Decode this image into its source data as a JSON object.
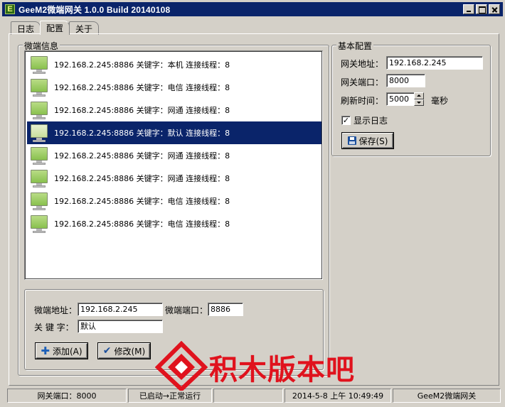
{
  "window": {
    "title": "GeeM2微端网关 1.0.0 Build 20140108",
    "icon_letter": "E"
  },
  "tabs": [
    {
      "label": "日志",
      "active": false
    },
    {
      "label": "配置",
      "active": true
    },
    {
      "label": "关于",
      "active": false
    }
  ],
  "client_info": {
    "group_label": "微端信息",
    "items": [
      {
        "text": "192.168.2.245:8886 关键字：本机 连接线程：8",
        "selected": false
      },
      {
        "text": "192.168.2.245:8886 关键字：电信 连接线程：8",
        "selected": false
      },
      {
        "text": "192.168.2.245:8886 关键字：网通 连接线程：8",
        "selected": false
      },
      {
        "text": "192.168.2.245:8886 关键字：默认 连接线程：8",
        "selected": true
      },
      {
        "text": "192.168.2.245:8886 关键字：网通 连接线程：8",
        "selected": false
      },
      {
        "text": "192.168.2.245:8886 关键字：网通 连接线程：8",
        "selected": false
      },
      {
        "text": "192.168.2.245:8886 关键字：电信 连接线程：8",
        "selected": false
      },
      {
        "text": "192.168.2.245:8886 关键字：电信 连接线程：8",
        "selected": false
      }
    ],
    "form": {
      "address_label": "微端地址：",
      "address_value": "192.168.2.245",
      "port_label": "微端端口：",
      "port_value": "8886",
      "keyword_label": "关 键 字：",
      "keyword_value": "默认",
      "add_button": "添加(A)",
      "edit_button": "修改(M)"
    }
  },
  "basic_config": {
    "group_label": "基本配置",
    "gateway_address_label": "网关地址：",
    "gateway_address_value": "192.168.2.245",
    "gateway_port_label": "网关端口：",
    "gateway_port_value": "8000",
    "refresh_label": "刷新时间：",
    "refresh_value": "5000",
    "refresh_unit": "毫秒",
    "show_log_label": "显示日志",
    "show_log_checked": true,
    "save_button": "保存(S)"
  },
  "status_bar": {
    "port": "网关端口：8000",
    "state": "已启动→正常运行",
    "empty": "",
    "datetime": "2014-5-8 上午 10:49:49",
    "app": "GeeM2微端网关"
  },
  "watermark": {
    "text": "积木版本吧"
  },
  "colors": {
    "titlebar": "#0a246a",
    "selection": "#0a246a",
    "face": "#d4d0c8",
    "watermark": "#e0121d"
  }
}
